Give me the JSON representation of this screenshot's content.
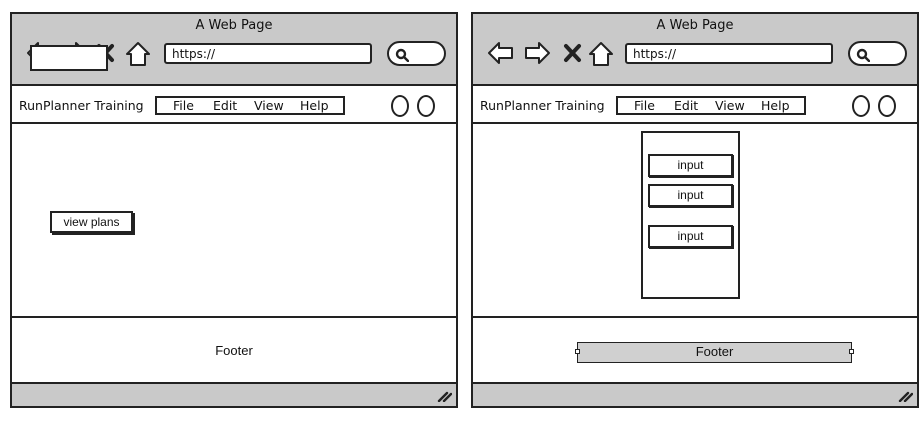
{
  "windows": [
    {
      "title": "A Web Page",
      "url": "https://",
      "brand": "RunPlanner Training",
      "menu": [
        "File",
        "Edit",
        "View",
        "Help"
      ],
      "view_plans_label": "view plans",
      "footer": "Footer"
    },
    {
      "title": "A Web Page",
      "url": "https://",
      "brand": "RunPlanner Training",
      "menu": [
        "File",
        "Edit",
        "View",
        "Help"
      ],
      "form_inputs": [
        "input",
        "input",
        "input"
      ],
      "footer": "Footer"
    }
  ],
  "icons": [
    "back-arrow-icon",
    "forward-arrow-icon",
    "close-x-icon",
    "home-icon",
    "search-icon",
    "resize-grip-icon"
  ]
}
